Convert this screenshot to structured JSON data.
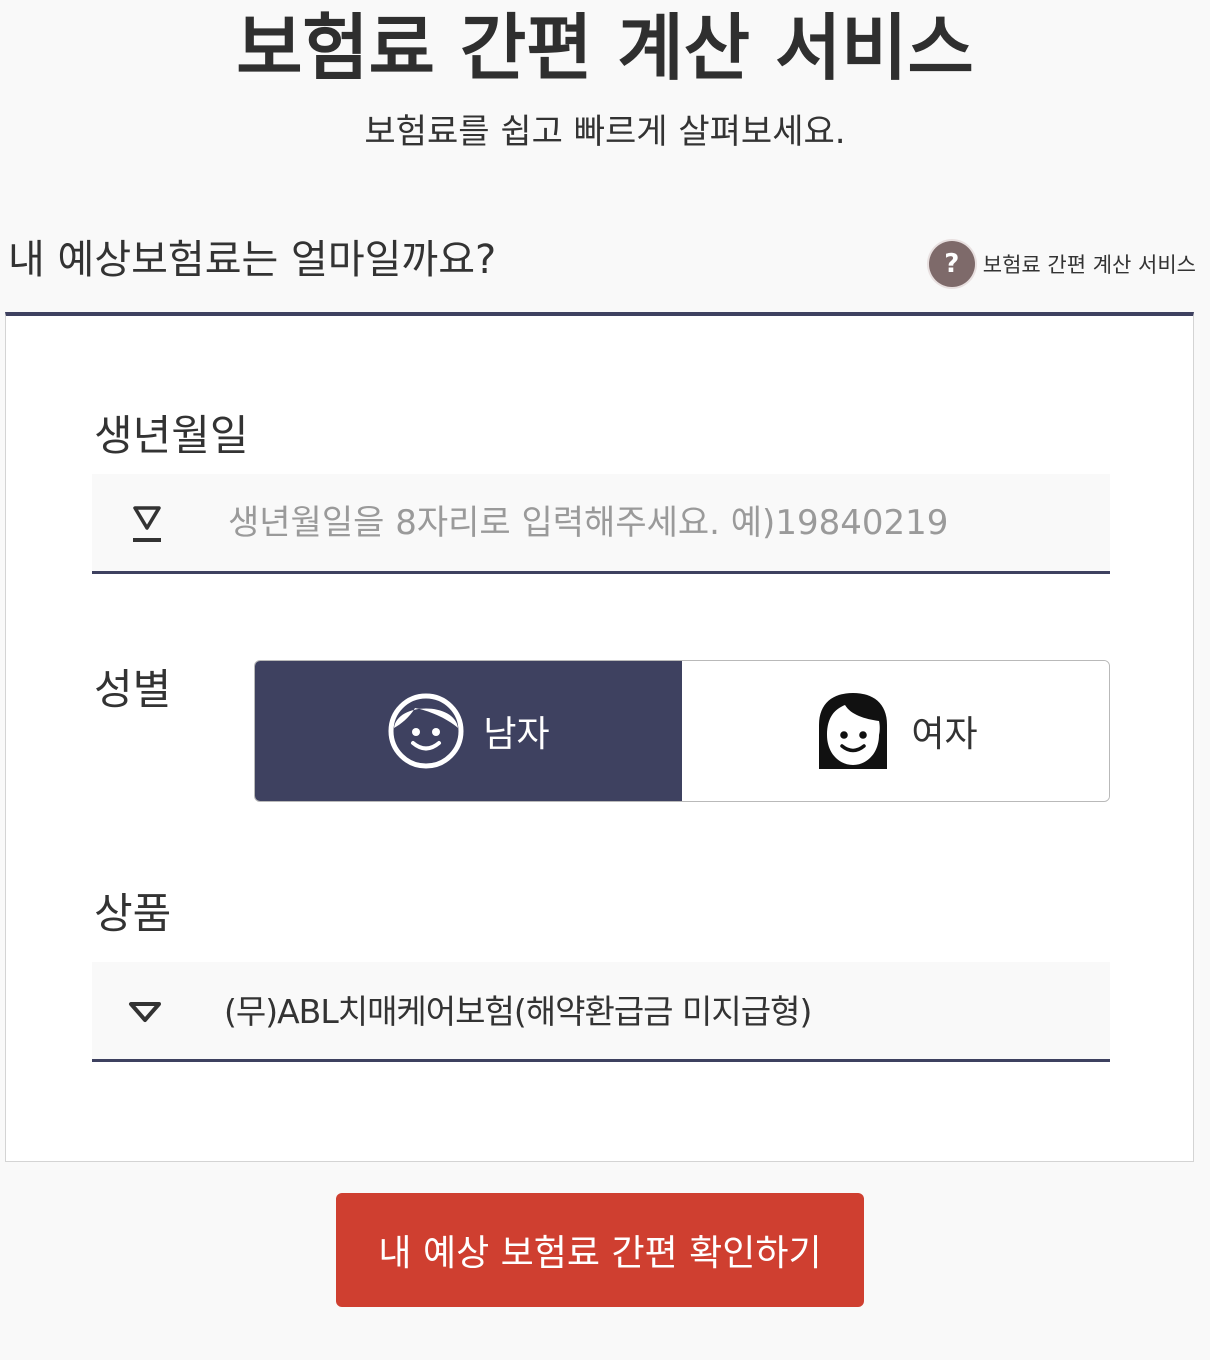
{
  "header": {
    "title": "보험료 간편 계산 서비스",
    "subtitle": "보험료를 쉽고 빠르게 살펴보세요."
  },
  "section": {
    "question": "내 예상보험료는 얼마일까요?",
    "help_label": "보험료 간편 계산 서비스",
    "help_icon_text": "?"
  },
  "form": {
    "birth": {
      "label": "생년월일",
      "value": "",
      "placeholder": "생년월일을 8자리로 입력해주세요. 예)19840219"
    },
    "gender": {
      "label": "성별",
      "options": [
        {
          "label": "남자",
          "selected": true
        },
        {
          "label": "여자",
          "selected": false
        }
      ]
    },
    "product": {
      "label": "상품",
      "selected": "(무)ABL치매케어보험(해약환급금 미지급형)"
    }
  },
  "submit": {
    "label": "내 예상 보험료 간편 확인하기"
  },
  "colors": {
    "navy": "#3e4160",
    "red": "#cf3f30",
    "help_icon": "#7e6a6a",
    "background": "#f9f9f9"
  },
  "icons": {
    "birth": "person-icon",
    "male": "male-face-icon",
    "female": "female-face-icon",
    "select": "triangle-down-icon",
    "help": "question-icon"
  }
}
